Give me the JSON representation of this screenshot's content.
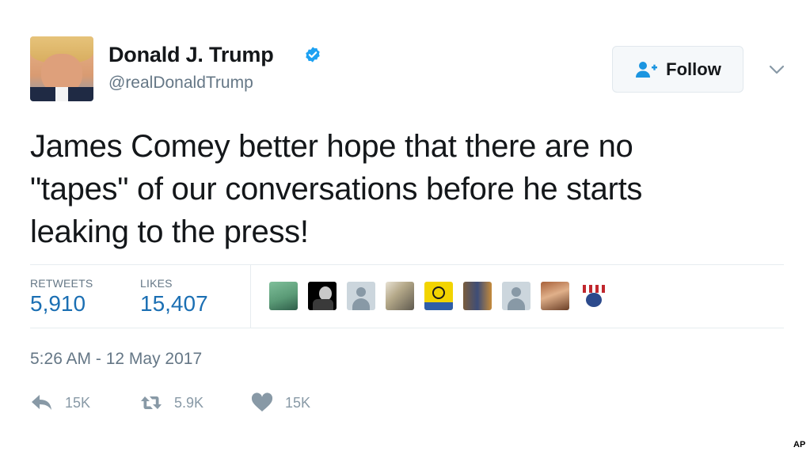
{
  "author": {
    "name": "Donald J. Trump",
    "handle": "@realDonaldTrump",
    "verified": true
  },
  "follow": {
    "label": "Follow",
    "icon": "add-user-icon"
  },
  "tweet": {
    "lines": [
      "James Comey better hope that there are no",
      "\"tapes\" of our conversations before he starts",
      "leaking to the press!"
    ]
  },
  "stats": {
    "retweets_label": "RETWEETS",
    "retweets_value": "5,910",
    "likes_label": "LIKES",
    "likes_value": "15,407"
  },
  "timestamp": "5:26 AM - 12 May 2017",
  "actions": {
    "reply_count": "15K",
    "retweet_count": "5.9K",
    "like_count": "15K"
  },
  "credit": "AP",
  "colors": {
    "link_blue": "#1b6fb3",
    "verified_blue": "#1da1f2",
    "muted_gray": "#657786",
    "action_gray": "#8899a6"
  }
}
